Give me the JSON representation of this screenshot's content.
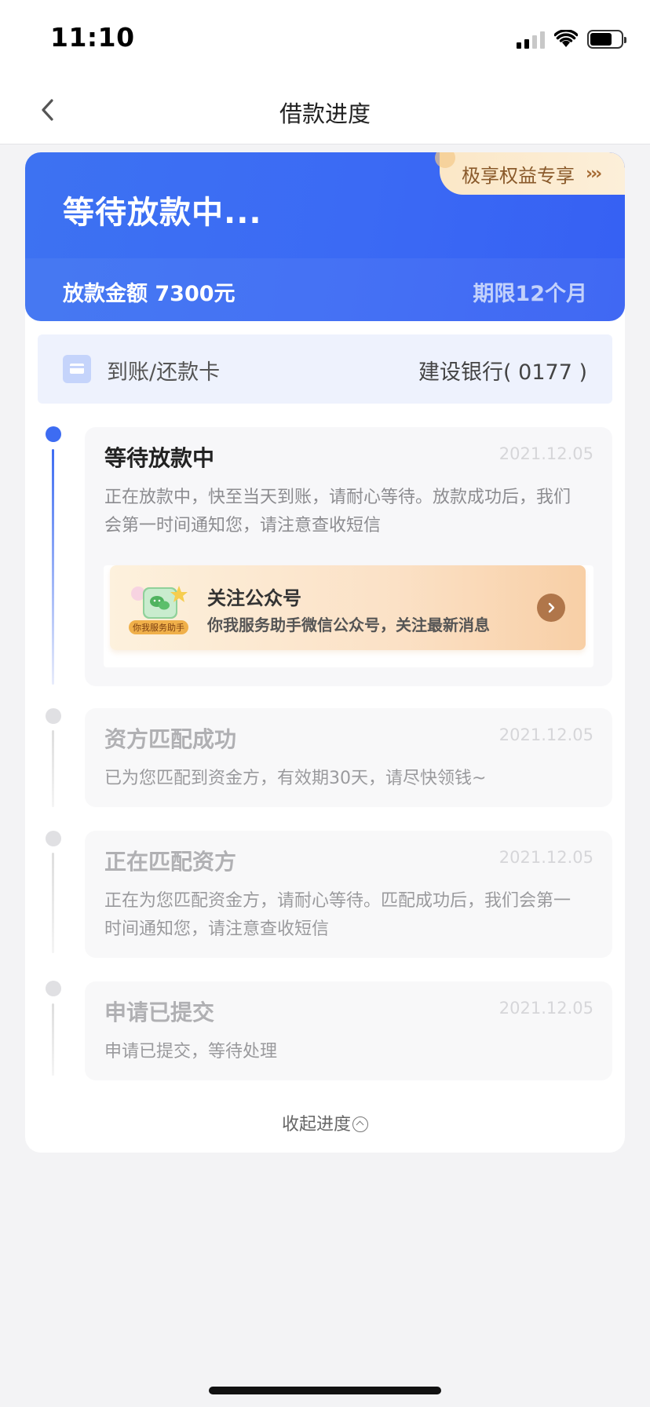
{
  "status_bar": {
    "time": "11:10"
  },
  "nav": {
    "title": "借款进度"
  },
  "hero": {
    "status_title": "等待放款中...",
    "amount_text": "放款金额 7300元",
    "term_text": "期限12个月",
    "vip_label": "极享权益专享",
    "vip_arrows": "›››"
  },
  "card_row": {
    "label": "到账/还款卡",
    "value": "建设银行( 0177 )"
  },
  "steps": [
    {
      "title": "等待放款中",
      "date": "2021.12.05",
      "desc": "正在放款中，快至当天到账，请耐心等待。放款成功后，我们会第一时间通知您，请注意查收短信",
      "active": true
    },
    {
      "title": "资方匹配成功",
      "date": "2021.12.05",
      "desc": "已为您匹配到资金方，有效期30天，请尽快领钱~",
      "active": false
    },
    {
      "title": "正在匹配资方",
      "date": "2021.12.05",
      "desc": "正在为您匹配资金方，请耐心等待。匹配成功后，我们会第一时间通知您，请注意查收短信",
      "active": false
    },
    {
      "title": "申请已提交",
      "date": "2021.12.05",
      "desc": "申请已提交，等待处理",
      "active": false
    }
  ],
  "promo": {
    "title": "关注公众号",
    "subtitle": "你我服务助手微信公众号，关注最新消息",
    "icon_caption": "你我服务助手"
  },
  "collapse": {
    "label": "收起进度"
  },
  "colors": {
    "primary": "#3d6cf2",
    "vip_bg": "#fbe7c7",
    "promo_accent": "#b0764a"
  }
}
